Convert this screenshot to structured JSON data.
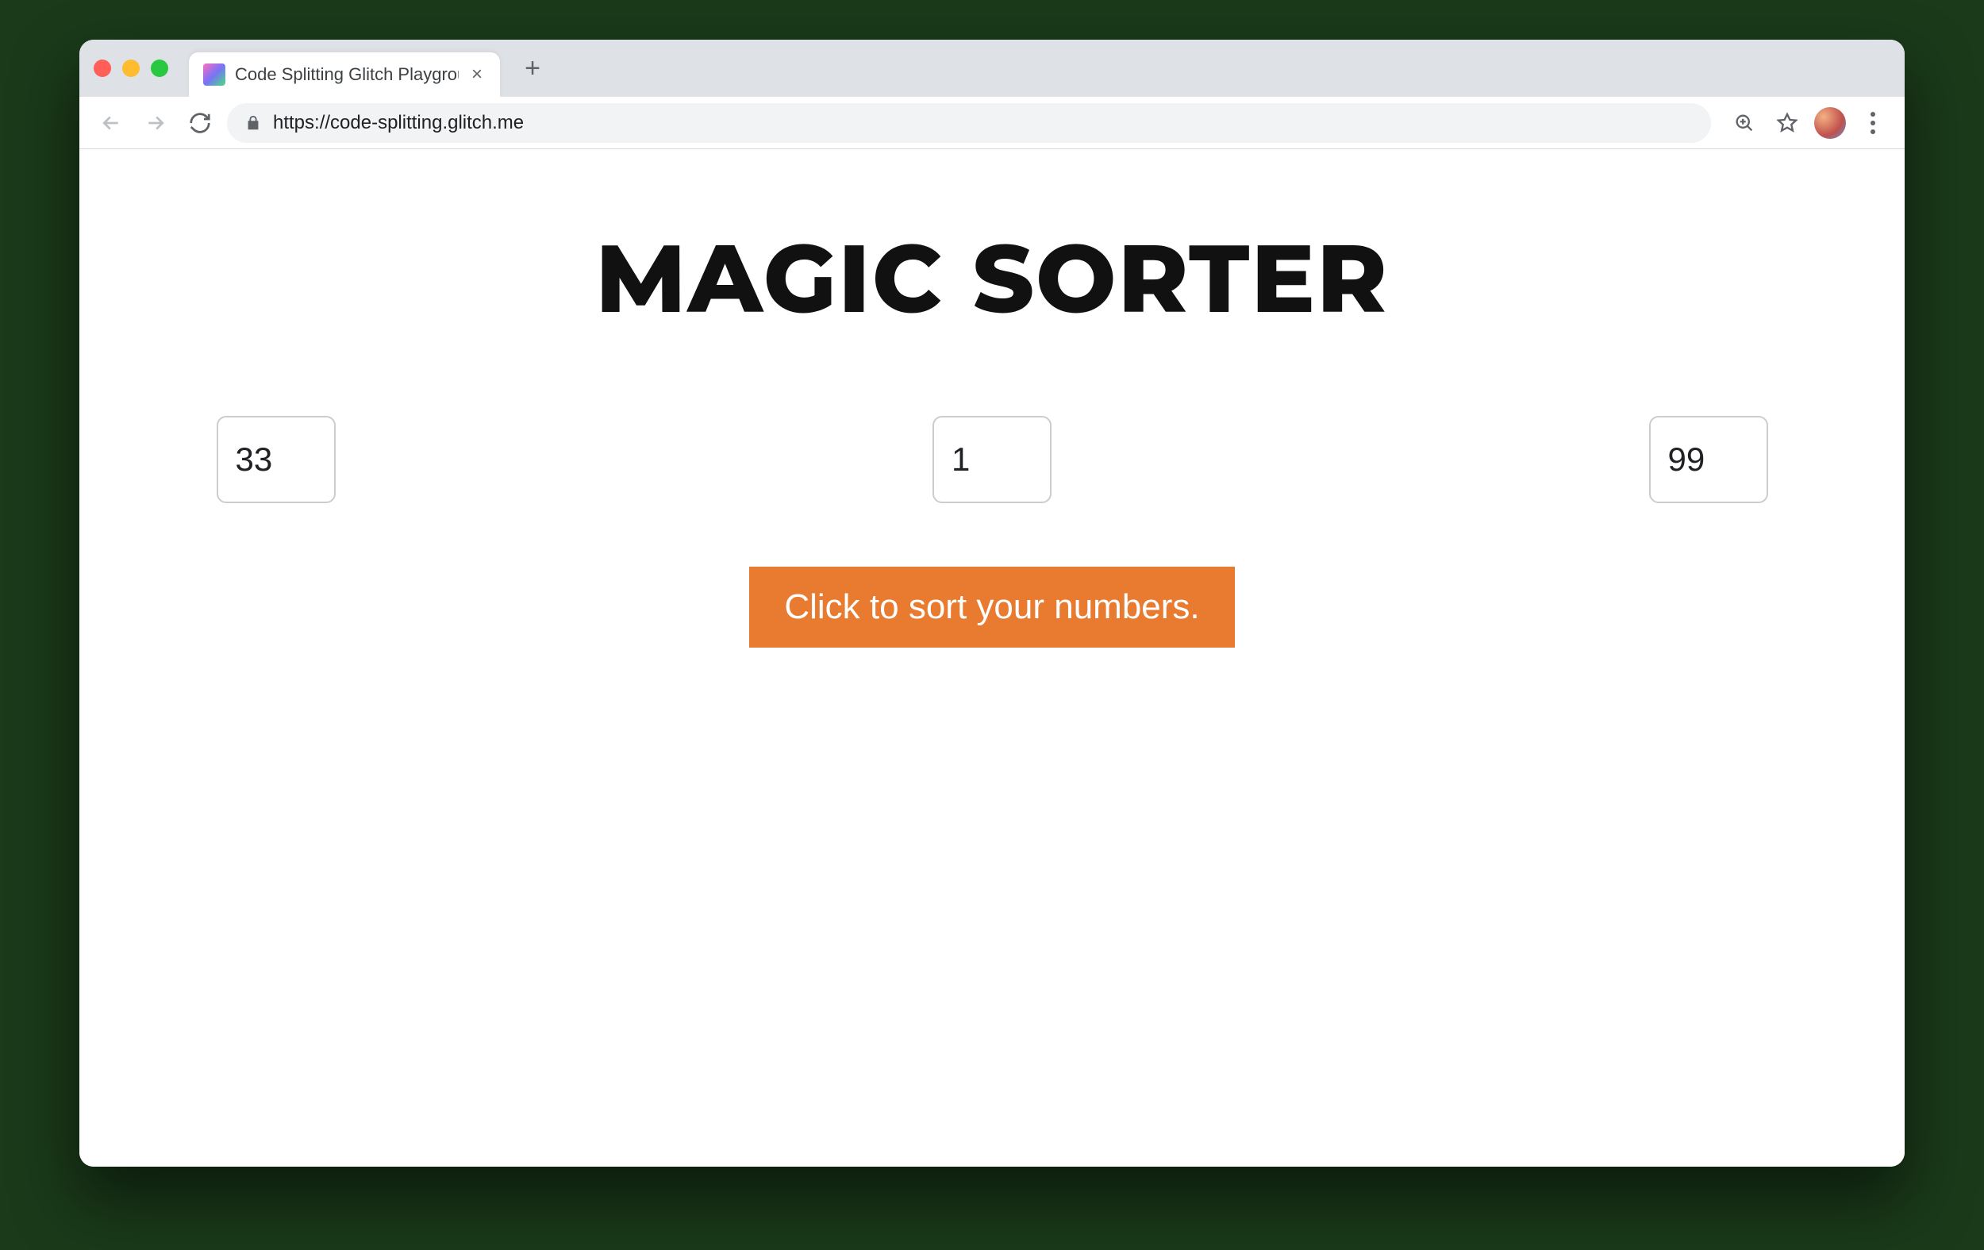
{
  "browser": {
    "tab_title": "Code Splitting Glitch Playgroun",
    "url": "https://code-splitting.glitch.me"
  },
  "page": {
    "heading": "MAGIC SORTER",
    "inputs": {
      "value1": "33",
      "value2": "1",
      "value3": "99"
    },
    "sort_button_label": "Click to sort your numbers."
  },
  "colors": {
    "accent": "#e87b2f"
  }
}
